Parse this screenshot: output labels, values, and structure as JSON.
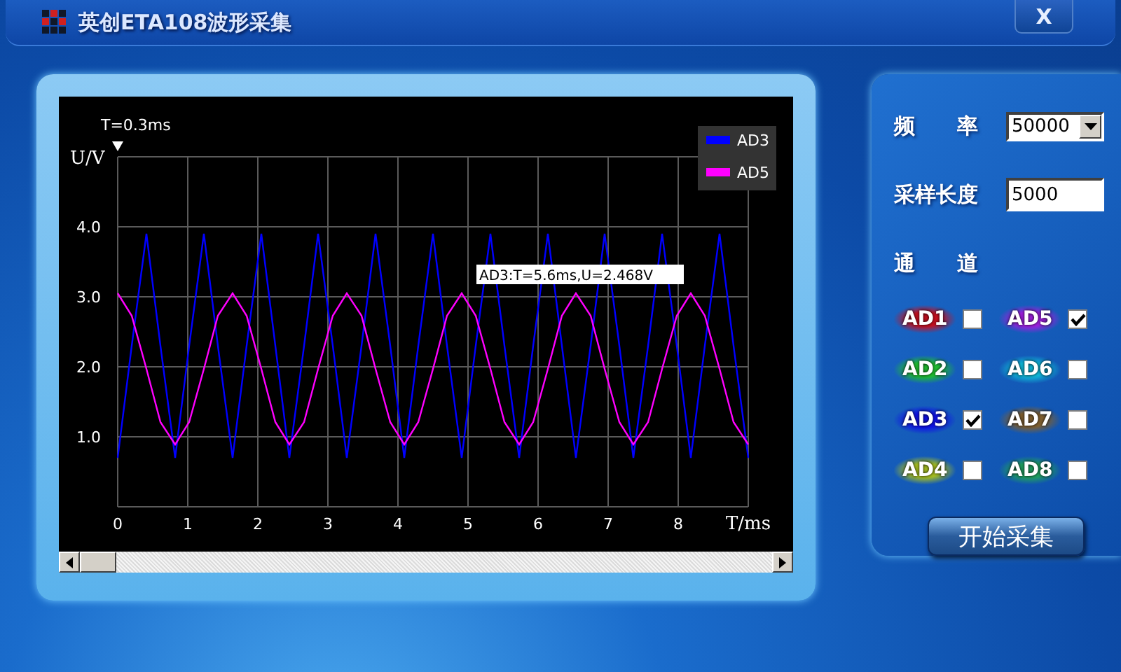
{
  "window": {
    "title": "英创ETA108波形采集",
    "close_label": "X"
  },
  "waveform": {
    "cursor_label": "T=0.3ms",
    "chart_data": {
      "type": "line",
      "xlabel": "T/ms",
      "ylabel": "U/V",
      "xlim": [
        0,
        9
      ],
      "ylim": [
        0,
        5
      ],
      "xticks": [
        0,
        1,
        2,
        3,
        4,
        5,
        6,
        7,
        8
      ],
      "yticks": [
        {
          "value": 1,
          "label": "1.0"
        },
        {
          "value": 2,
          "label": "2.0"
        },
        {
          "value": 3,
          "label": "3.0"
        },
        {
          "value": 4,
          "label": "4.0"
        }
      ],
      "x": [
        0,
        0.2,
        0.41,
        0.61,
        0.82,
        1.02,
        1.23,
        1.43,
        1.64,
        1.84,
        2.05,
        2.25,
        2.45,
        2.66,
        2.86,
        3.07,
        3.27,
        3.48,
        3.68,
        3.89,
        4.09,
        4.29,
        4.5,
        4.7,
        4.91,
        5.11,
        5.32,
        5.52,
        5.73,
        5.93,
        6.14,
        6.34,
        6.54,
        6.75,
        6.95,
        7.16,
        7.36,
        7.57,
        7.77,
        7.98,
        8.18,
        8.38,
        8.59,
        8.79,
        9.0
      ],
      "series": [
        {
          "name": "AD3",
          "color": "#0000ff",
          "values": [
            0.7,
            2.3,
            3.9,
            2.3,
            0.7,
            2.3,
            3.9,
            2.3,
            0.7,
            2.3,
            3.9,
            2.3,
            0.7,
            2.3,
            3.9,
            2.3,
            0.7,
            2.3,
            3.9,
            2.3,
            0.7,
            2.3,
            3.9,
            2.3,
            0.7,
            2.3,
            3.9,
            2.3,
            0.7,
            2.3,
            3.9,
            2.3,
            0.7,
            2.3,
            3.9,
            2.3,
            0.7,
            2.3,
            3.9,
            2.3,
            0.7,
            2.3,
            3.9,
            2.3,
            0.7
          ]
        },
        {
          "name": "AD5",
          "color": "#ff00ff",
          "values": [
            3.05,
            2.73,
            1.97,
            1.21,
            0.89,
            1.21,
            1.97,
            2.73,
            3.05,
            2.73,
            1.97,
            1.21,
            0.89,
            1.21,
            1.97,
            2.73,
            3.05,
            2.73,
            1.97,
            1.21,
            0.89,
            1.21,
            1.97,
            2.73,
            3.05,
            2.73,
            1.97,
            1.21,
            0.89,
            1.21,
            1.97,
            2.73,
            3.05,
            2.73,
            1.97,
            1.21,
            0.89,
            1.21,
            1.97,
            2.73,
            3.05,
            2.73,
            1.97,
            1.21,
            0.89
          ]
        }
      ],
      "grid": true,
      "legend": "top-right",
      "annotations": [
        "AD3:T=5.6ms,U=2.468V"
      ]
    }
  },
  "settings": {
    "frequency": {
      "label": "频　　率",
      "value": "50000"
    },
    "sample_length": {
      "label": "采样长度",
      "value": "5000"
    },
    "channels_label": "通　　道",
    "channels": [
      {
        "name": "AD1",
        "color": "#c81020",
        "checked": false
      },
      {
        "name": "AD5",
        "color": "#a020e0",
        "checked": true
      },
      {
        "name": "AD2",
        "color": "#20c030",
        "checked": false
      },
      {
        "name": "AD6",
        "color": "#10b8d8",
        "checked": false
      },
      {
        "name": "AD3",
        "color": "#1010e8",
        "checked": true
      },
      {
        "name": "AD7",
        "color": "#806030",
        "checked": false
      },
      {
        "name": "AD4",
        "color": "#a8c020",
        "checked": false
      },
      {
        "name": "AD8",
        "color": "#20a060",
        "checked": false
      }
    ],
    "start_button": "开始采集"
  }
}
